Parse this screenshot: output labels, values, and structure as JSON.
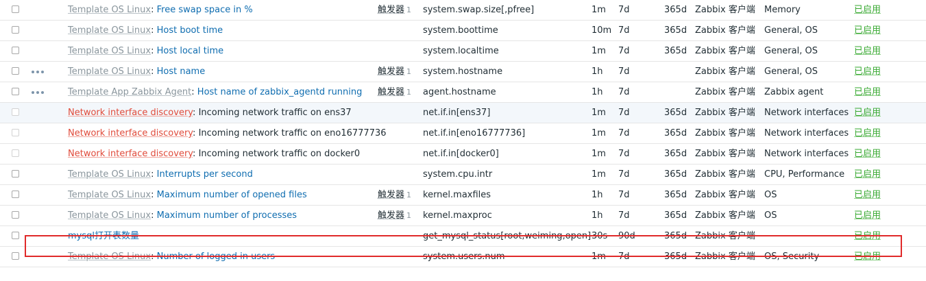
{
  "rows": [
    {
      "template": "Template OS Linux",
      "name": "Free swap space in %",
      "trigger": "触发器",
      "trigger_count": "1",
      "key": "system.swap.size[,pfree]",
      "interval": "1m",
      "history": "7d",
      "trends": "365d",
      "type": "Zabbix 客户端",
      "apps": "Memory",
      "status": "已启用"
    },
    {
      "template": "Template OS Linux",
      "name": "Host boot time",
      "trigger": "",
      "trigger_count": "",
      "key": "system.boottime",
      "interval": "10m",
      "history": "7d",
      "trends": "365d",
      "type": "Zabbix 客户端",
      "apps": "General, OS",
      "status": "已启用"
    },
    {
      "template": "Template OS Linux",
      "name": "Host local time",
      "trigger": "",
      "trigger_count": "",
      "key": "system.localtime",
      "interval": "1m",
      "history": "7d",
      "trends": "365d",
      "type": "Zabbix 客户端",
      "apps": "General, OS",
      "status": "已启用"
    },
    {
      "template": "Template OS Linux",
      "name": "Host name",
      "trigger": "触发器",
      "trigger_count": "1",
      "key": "system.hostname",
      "interval": "1h",
      "history": "7d",
      "trends": "",
      "type": "Zabbix 客户端",
      "apps": "General, OS",
      "status": "已启用"
    },
    {
      "template": "Template App Zabbix Agent",
      "name": "Host name of zabbix_agentd running",
      "trigger": "触发器",
      "trigger_count": "1",
      "key": "agent.hostname",
      "interval": "1h",
      "history": "7d",
      "trends": "",
      "type": "Zabbix 客户端",
      "apps": "Zabbix agent",
      "status": "已启用"
    },
    {
      "template": "Network interface discovery",
      "name": "Incoming network traffic on ens37",
      "trigger": "",
      "trigger_count": "",
      "key": "net.if.in[ens37]",
      "interval": "1m",
      "history": "7d",
      "trends": "365d",
      "type": "Zabbix 客户端",
      "apps": "Network interfaces",
      "status": "已启用"
    },
    {
      "template": "Network interface discovery",
      "name": "Incoming network traffic on eno16777736",
      "trigger": "",
      "trigger_count": "",
      "key": "net.if.in[eno16777736]",
      "interval": "1m",
      "history": "7d",
      "trends": "365d",
      "type": "Zabbix 客户端",
      "apps": "Network interfaces",
      "status": "已启用"
    },
    {
      "template": "Network interface discovery",
      "name": "Incoming network traffic on docker0",
      "trigger": "",
      "trigger_count": "",
      "key": "net.if.in[docker0]",
      "interval": "1m",
      "history": "7d",
      "trends": "365d",
      "type": "Zabbix 客户端",
      "apps": "Network interfaces",
      "status": "已启用"
    },
    {
      "template": "Template OS Linux",
      "name": "Interrupts per second",
      "trigger": "",
      "trigger_count": "",
      "key": "system.cpu.intr",
      "interval": "1m",
      "history": "7d",
      "trends": "365d",
      "type": "Zabbix 客户端",
      "apps": "CPU, Performance",
      "status": "已启用"
    },
    {
      "template": "Template OS Linux",
      "name": "Maximum number of opened files",
      "trigger": "触发器",
      "trigger_count": "1",
      "key": "kernel.maxfiles",
      "interval": "1h",
      "history": "7d",
      "trends": "365d",
      "type": "Zabbix 客户端",
      "apps": "OS",
      "status": "已启用"
    },
    {
      "template": "Template OS Linux",
      "name": "Maximum number of processes",
      "trigger": "触发器",
      "trigger_count": "1",
      "key": "kernel.maxproc",
      "interval": "1h",
      "history": "7d",
      "trends": "365d",
      "type": "Zabbix 客户端",
      "apps": "OS",
      "status": "已启用"
    },
    {
      "template": "",
      "name": "mysql打开表数量",
      "trigger": "",
      "trigger_count": "",
      "key": "get_mysql_status[root,weiming,open]",
      "interval": "30s",
      "history": "90d",
      "trends": "365d",
      "type": "Zabbix 客户端",
      "apps": "",
      "status": "已启用"
    },
    {
      "template": "Template OS Linux",
      "name": "Number of logged in users",
      "trigger": "",
      "trigger_count": "",
      "key": "system.users.num",
      "interval": "1m",
      "history": "7d",
      "trends": "365d",
      "type": "Zabbix 客户端",
      "apps": "OS, Security",
      "status": "已启用"
    }
  ]
}
